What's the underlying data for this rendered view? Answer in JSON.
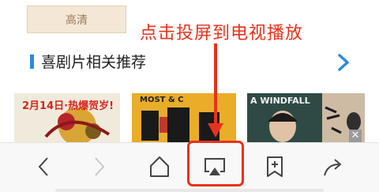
{
  "quality_button": {
    "label": "高清"
  },
  "annotation": {
    "text": "点击投屏到电视播放",
    "color": "#e8321c"
  },
  "section": {
    "title": "喜剧片相关推荐",
    "accent_color": "#2b8be0"
  },
  "posters": [
    {
      "label": "2月14日·热爆贺岁!"
    },
    {
      "label": "MOST & C"
    },
    {
      "label": "A WINDFALL"
    },
    {
      "label": ""
    }
  ],
  "ad_close": {
    "label": "✕"
  },
  "toolbar": {
    "items": [
      {
        "icon": "back-icon"
      },
      {
        "icon": "forward-icon"
      },
      {
        "icon": "home-icon"
      },
      {
        "icon": "cast-screen-icon"
      },
      {
        "icon": "bookmark-add-icon"
      },
      {
        "icon": "share-icon"
      }
    ]
  }
}
